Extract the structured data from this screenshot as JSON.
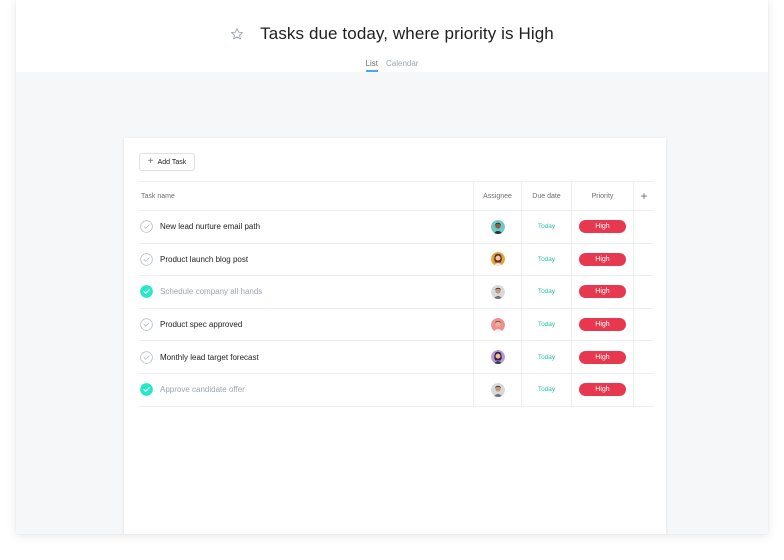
{
  "header": {
    "title": "Tasks due today, where priority is High",
    "tabs": [
      {
        "label": "List",
        "active": true
      },
      {
        "label": "Calendar",
        "active": false
      }
    ]
  },
  "toolbar": {
    "add_task_label": "Add Task"
  },
  "table": {
    "columns": {
      "name": "Task name",
      "assignee": "Assignee",
      "due": "Due date",
      "priority": "Priority",
      "add": "+"
    },
    "rows": [
      {
        "name": "New lead nurture email path",
        "completed": false,
        "due": "Today",
        "priority": "High"
      },
      {
        "name": "Product launch blog post",
        "completed": false,
        "due": "Today",
        "priority": "High"
      },
      {
        "name": "Schedule company all hands",
        "completed": true,
        "due": "Today",
        "priority": "High"
      },
      {
        "name": "Product spec approved",
        "completed": false,
        "due": "Today",
        "priority": "High"
      },
      {
        "name": "Monthly lead target forecast",
        "completed": false,
        "due": "Today",
        "priority": "High"
      },
      {
        "name": "Approve candidate offer",
        "completed": true,
        "due": "Today",
        "priority": "High"
      }
    ]
  },
  "colors": {
    "accent_tab": "#4aa9e0",
    "due_today": "#25c4a3",
    "priority_high": "#e8384f",
    "completed_check": "#25e8c8"
  }
}
